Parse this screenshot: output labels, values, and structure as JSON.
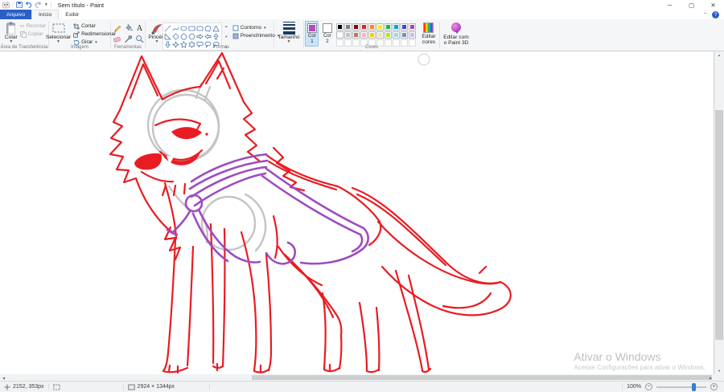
{
  "theme": {
    "accent": "#2a5fc4",
    "slider_thumb": "#2f7ed8"
  },
  "titlebar": {
    "title": "Sem título - Paint"
  },
  "tabs": {
    "file": "Arquivo",
    "home": "Início",
    "view": "Exibir"
  },
  "ribbon": {
    "clipboard": {
      "group_label": "Área de Transferência",
      "paste": "Colar",
      "cut": "Recortar",
      "copy": "Copiar"
    },
    "image": {
      "group_label": "Imagem",
      "select": "Selecionar",
      "crop": "Cortar",
      "resize": "Redimensionar",
      "rotate": "Girar"
    },
    "tools": {
      "group_label": "Ferramentas",
      "brushes": "Pincéis",
      "tool_names": [
        "pencil",
        "fill",
        "text",
        "eraser",
        "color-picker",
        "magnifier"
      ]
    },
    "shapes": {
      "group_label": "Formas",
      "outline": "Contorno",
      "fill": "Preenchimento",
      "shape_names": [
        "line",
        "curve",
        "oval",
        "rectangle",
        "rounded-rectangle",
        "polygon",
        "triangle",
        "right-triangle",
        "diamond",
        "pentagon",
        "hexagon",
        "arrow-right",
        "arrow-left",
        "arrow-up",
        "arrow-down",
        "star-4",
        "star-5",
        "star-6",
        "callout-rounded",
        "callout-oval",
        "callout-cloud"
      ]
    },
    "size": {
      "label": "Tamanho"
    },
    "colors": {
      "group_label": "Cores",
      "color1_label": "Cor\n1",
      "color2_label": "Cor\n2",
      "color1_value": "#b14dc1",
      "color2_value": "#ffffff",
      "edit_colors_label": "Editar\ncores",
      "edit_3d_label": "Editar com\no Paint 3D",
      "palette_row1": [
        "#000000",
        "#7f7f7f",
        "#880015",
        "#ed1c24",
        "#ff7f27",
        "#fff200",
        "#22b14c",
        "#00a2e8",
        "#3f48cc",
        "#a349a4"
      ],
      "palette_row2": [
        "#ffffff",
        "#c3c3c3",
        "#b97a57",
        "#ffaec9",
        "#ffc90e",
        "#efe4b0",
        "#b5e61d",
        "#99d9ea",
        "#7092be",
        "#c8bfe7"
      ],
      "empty_custom_slots": 10
    }
  },
  "canvas": {
    "sketch_colors": {
      "red": "#e91c22",
      "purple": "#9d4cc3",
      "gray": "#c4c4c4"
    }
  },
  "watermark": {
    "title": "Ativar o Windows",
    "subtitle": "Acesse Configurações para ativar o Windows."
  },
  "statusbar": {
    "cursor_position": "2152, 353px",
    "canvas_size": "2924 × 1344px",
    "zoom_level": "100%"
  }
}
